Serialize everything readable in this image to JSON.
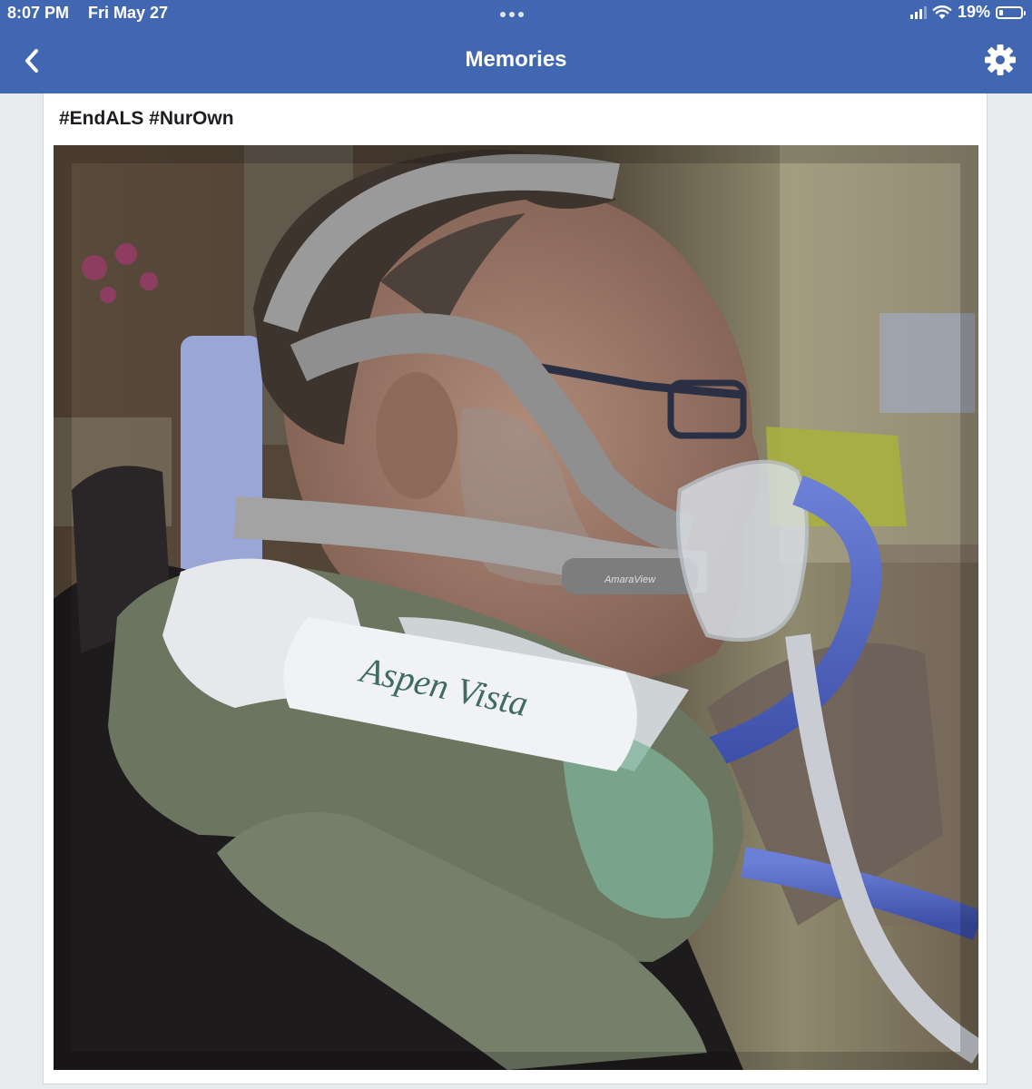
{
  "status_bar": {
    "time": "8:07 PM",
    "date": "Fri May 27",
    "battery_percent": "19%",
    "battery_level": 0.19,
    "icons": [
      "signal-icon",
      "wifi-icon",
      "battery-icon"
    ]
  },
  "header": {
    "title": "Memories",
    "back_icon": "chevron-left-icon",
    "settings_icon": "gear-icon"
  },
  "post": {
    "text": "#EndALS #NurOwn",
    "photo_brand_logo": "Aspen Vista",
    "photo_mask_strap_label": "AmaraView"
  },
  "colors": {
    "header_bg": "#4267b2",
    "page_bg": "#e9ebee",
    "card_bg": "#ffffff"
  }
}
